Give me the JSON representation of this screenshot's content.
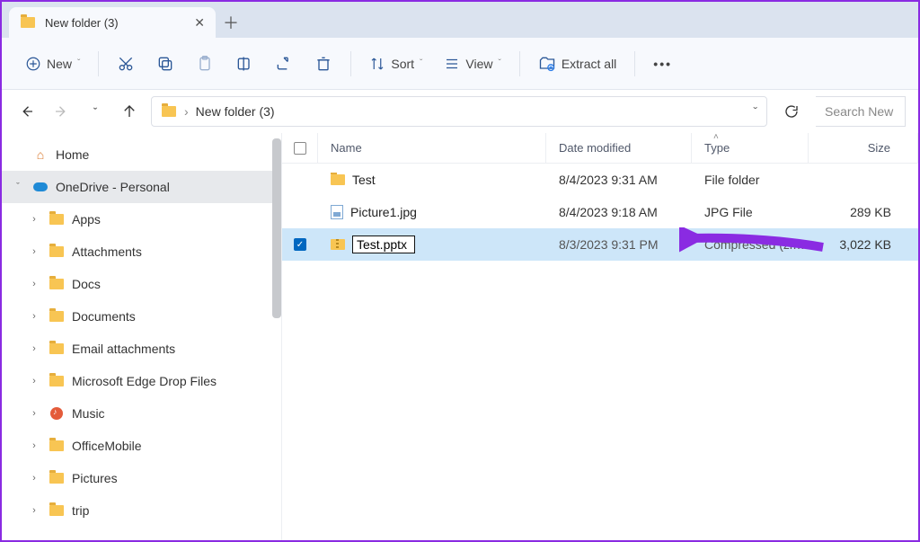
{
  "tab": {
    "title": "New folder (3)"
  },
  "toolbar": {
    "new_label": "New",
    "sort_label": "Sort",
    "view_label": "View",
    "extract_label": "Extract all"
  },
  "breadcrumb": [
    "New folder (3)"
  ],
  "search_placeholder": "Search New",
  "nav": {
    "home": "Home",
    "onedrive": "OneDrive - Personal",
    "items": [
      "Apps",
      "Attachments",
      "Docs",
      "Documents",
      "Email attachments",
      "Microsoft Edge Drop Files",
      "Music",
      "OfficeMobile",
      "Pictures",
      "trip"
    ]
  },
  "columns": {
    "name": "Name",
    "date": "Date modified",
    "type": "Type",
    "size": "Size"
  },
  "files": [
    {
      "name": "Test",
      "date": "8/4/2023 9:31 AM",
      "type": "File folder",
      "size": "",
      "icon": "folder",
      "selected": false,
      "rename": false
    },
    {
      "name": "Picture1.jpg",
      "date": "8/4/2023 9:18 AM",
      "type": "JPG File",
      "size": "289 KB",
      "icon": "image",
      "selected": false,
      "rename": false
    },
    {
      "name": "Test.pptx",
      "date": "8/3/2023 9:31 PM",
      "type": "Compressed (zipp...",
      "size": "3,022 KB",
      "icon": "zip",
      "selected": true,
      "rename": true
    }
  ]
}
